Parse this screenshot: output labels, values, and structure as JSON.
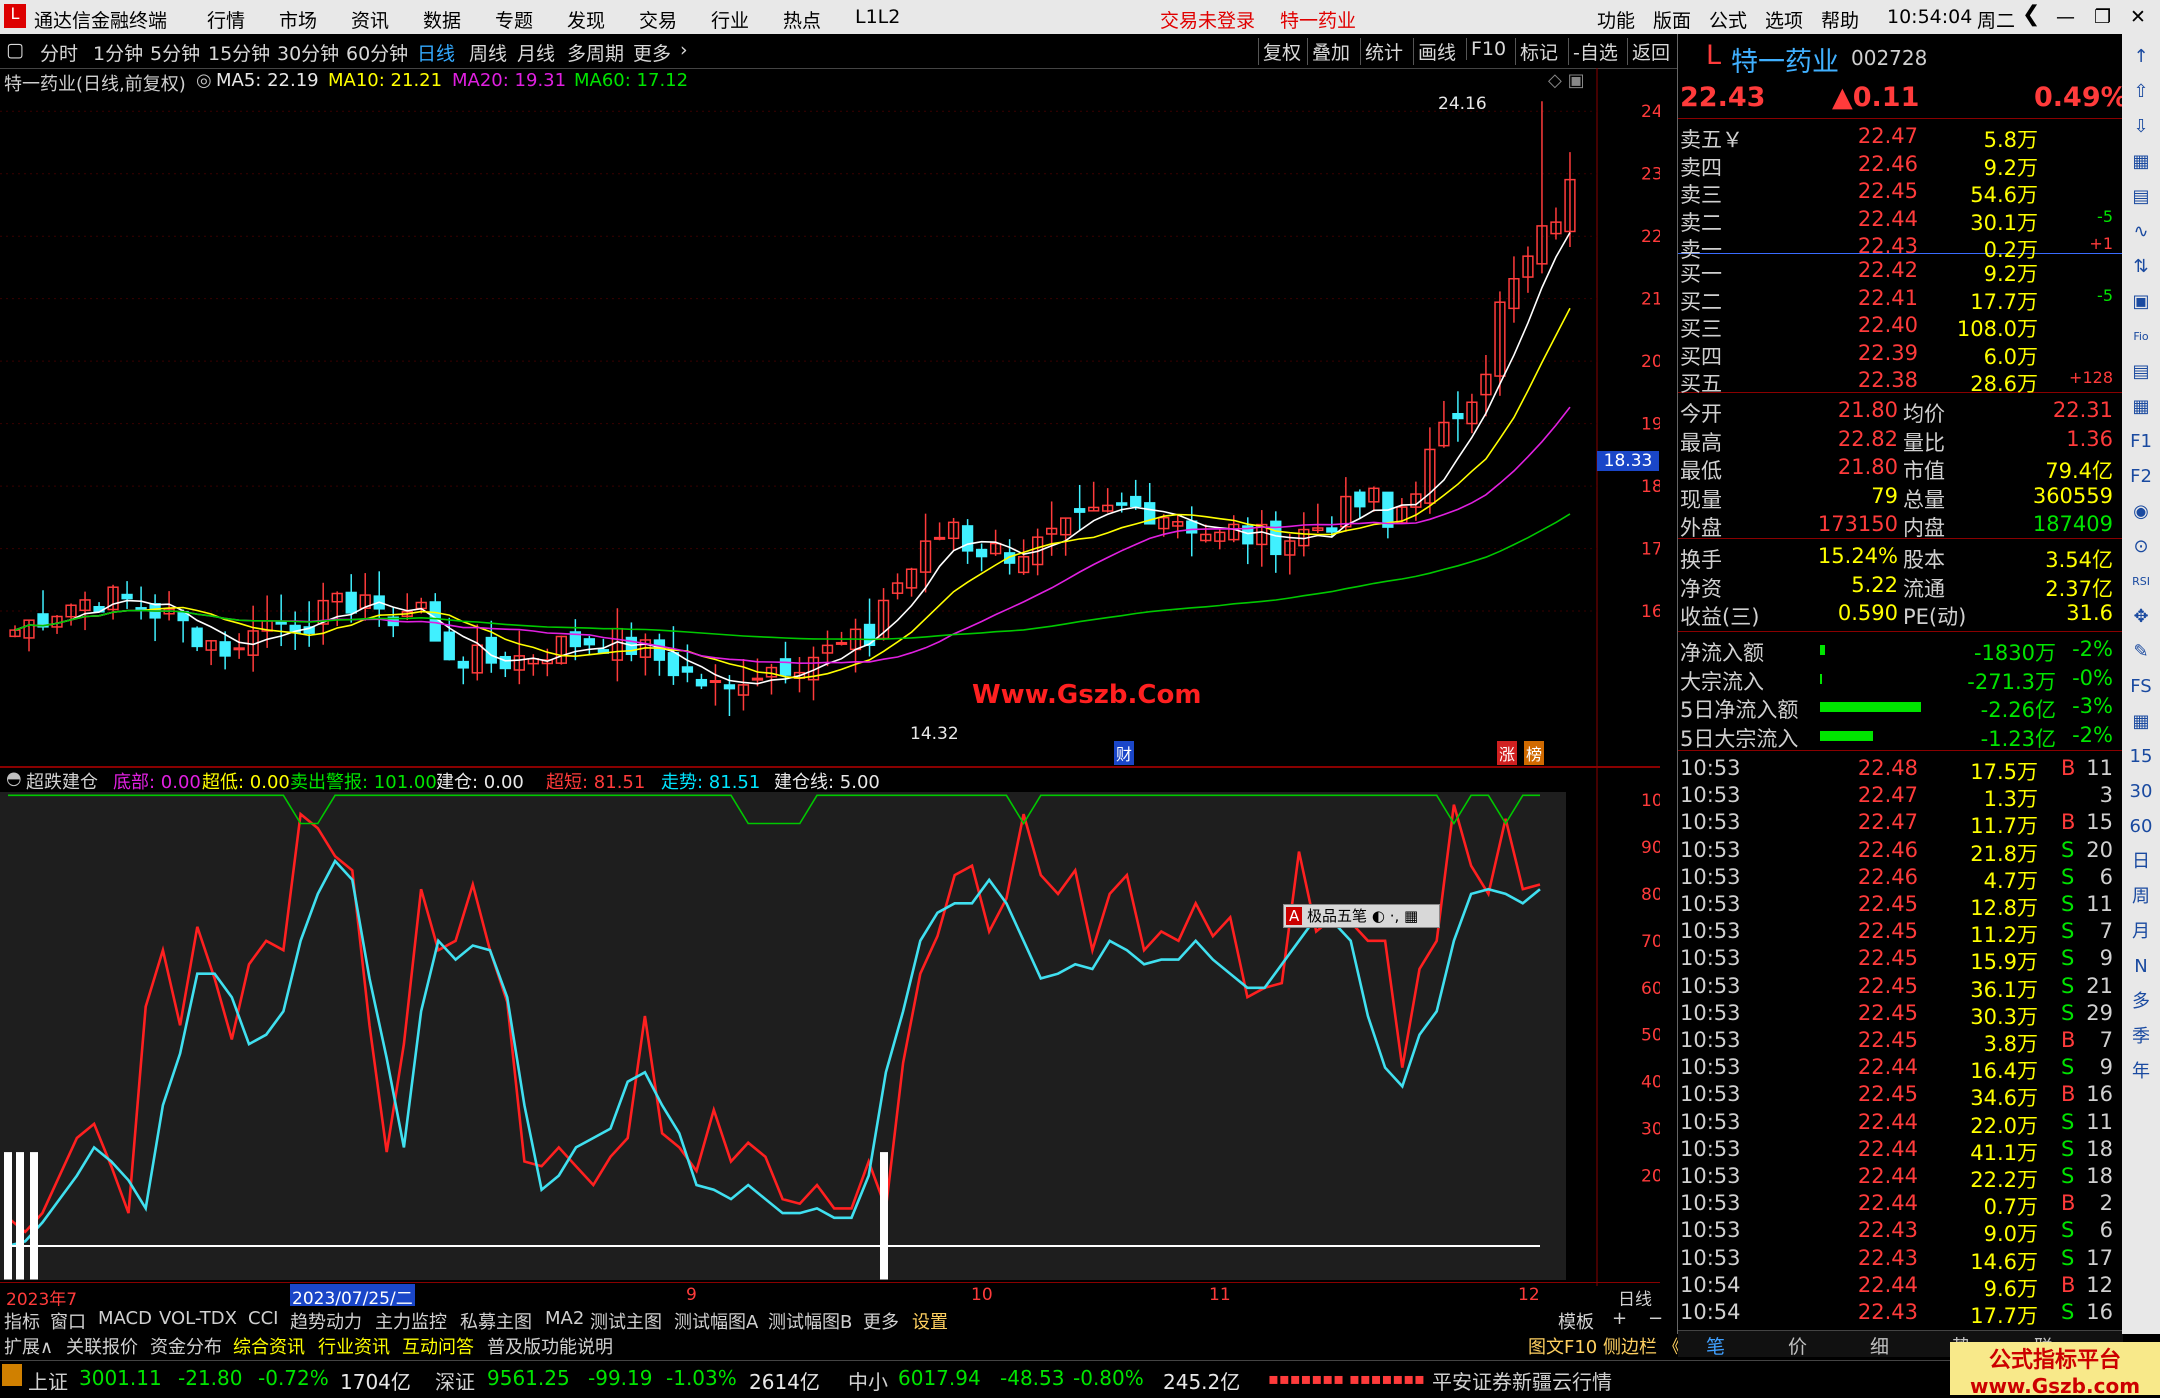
{
  "app": {
    "title": "通达信金融终端",
    "menu": [
      "行情",
      "市场",
      "资讯",
      "数据",
      "专题",
      "发现",
      "交易",
      "行业",
      "热点",
      "L1L2"
    ],
    "login_status": "交易未登录",
    "stock_tab": "特一药业",
    "right_menu": [
      "功能",
      "版面",
      "公式",
      "选项",
      "帮助"
    ],
    "clock": "10:54:04",
    "weekday": "周二"
  },
  "timeframes": [
    "分时",
    "1分钟",
    "5分钟",
    "15分钟",
    "30分钟",
    "60分钟",
    "日线",
    "周线",
    "月线",
    "多周期",
    "更多"
  ],
  "active_timeframe": "日线",
  "toolbar_right": [
    "复权",
    "叠加",
    "统计",
    "画线",
    "F10",
    "标记",
    "-自选",
    "返回"
  ],
  "main_chart": {
    "stock_label": "特一药业(日线,前复权)",
    "ma5": "MA5: 22.19",
    "ma10": "MA10: 21.21",
    "ma20": "MA20: 19.31",
    "ma60": "MA60: 17.12",
    "high_label": "24.16",
    "low_label": "14.32",
    "price_axis": [
      "24.00",
      "23.00",
      "22.00",
      "21.00",
      "20.00",
      "19.00",
      "18.00",
      "17.00",
      "16.00"
    ],
    "current_price_tag": "18.33",
    "watermark": "Www.Gszb.Com",
    "marker_cai": "财",
    "marker_zhang": "涨",
    "marker_bang": "榜",
    "colors": {
      "up": "#ff3b3b",
      "down": "#40f0ff",
      "ma5": "#ffffff",
      "ma10": "#ffff00",
      "ma20": "#e020e0",
      "ma60": "#00c800"
    }
  },
  "indicator": {
    "name": "超跌建仓",
    "bottom": "底部: 0.00",
    "super_low": "超低: 0.00",
    "sell_warn": "卖出警报: 101.00",
    "build": "建仓: 0.00",
    "overshort": "超短: 81.51",
    "trend": "走势: 81.51",
    "build_line": "建仓线: 5.00",
    "axis": [
      "100.00",
      "90.00",
      "80.00",
      "70.00",
      "60.00",
      "50.00",
      "40.00",
      "30.00",
      "20.00"
    ],
    "popup_label": "极品五笔",
    "popup_letter": "A"
  },
  "date_axis": {
    "labels": [
      "2023年7",
      "2023/07/25/二",
      "9",
      "10",
      "11",
      "12"
    ],
    "period": "日线"
  },
  "chart_data": [
    {
      "type": "line",
      "title": "超跌建仓",
      "series": [
        {
          "name": "超短",
          "values": [
            11,
            8,
            12,
            20,
            28,
            31,
            22,
            12,
            56,
            68,
            52,
            73,
            62,
            49,
            65,
            70,
            68,
            97,
            94,
            88,
            85,
            52,
            25,
            48,
            81,
            68,
            70,
            82,
            68,
            57,
            23,
            22,
            26,
            22,
            18,
            24,
            28,
            54,
            29,
            26,
            21,
            34,
            23,
            27,
            24,
            15,
            14,
            18,
            13,
            13,
            23,
            13,
            44,
            63,
            71,
            84,
            86,
            72,
            79,
            97,
            84,
            80,
            85,
            68,
            80,
            84,
            68,
            72,
            70,
            78,
            71,
            75,
            58,
            60,
            61,
            89,
            72,
            75,
            74,
            70,
            70,
            43,
            64,
            70,
            99,
            86,
            80,
            96,
            81,
            82
          ]
        },
        {
          "name": "走势",
          "values": [
            5,
            6,
            10,
            15,
            20,
            26,
            23,
            19,
            13,
            35,
            46,
            63,
            63,
            58,
            48,
            50,
            55,
            70,
            80,
            87,
            83,
            62,
            45,
            26,
            55,
            70,
            66,
            69,
            68,
            58,
            35,
            17,
            20,
            26,
            28,
            30,
            40,
            42,
            35,
            29,
            18,
            17,
            15,
            18,
            15,
            12,
            12,
            13,
            11,
            11,
            20,
            42,
            55,
            70,
            76,
            78,
            78,
            83,
            78,
            70,
            62,
            63,
            65,
            64,
            70,
            68,
            65,
            66,
            66,
            70,
            66,
            63,
            60,
            60,
            65,
            70,
            75,
            74,
            70,
            54,
            43,
            39,
            50,
            55,
            70,
            80,
            81,
            80,
            78,
            81
          ]
        }
      ],
      "ylim": [
        0,
        100
      ]
    }
  ],
  "quote_panel": {
    "code_prefix": "L",
    "name": "特一药业",
    "code": "002728",
    "price": "22.43",
    "change": "▲0.11",
    "change_pct": "0.49%",
    "asks": [
      {
        "label": "卖五",
        "price": "22.47",
        "vol": "5.8万",
        "chg": ""
      },
      {
        "label": "卖四",
        "price": "22.46",
        "vol": "9.2万",
        "chg": ""
      },
      {
        "label": "卖三",
        "price": "22.45",
        "vol": "54.6万",
        "chg": ""
      },
      {
        "label": "卖二",
        "price": "22.44",
        "vol": "30.1万",
        "chg": "-5"
      },
      {
        "label": "卖一",
        "price": "22.43",
        "vol": "0.2万",
        "chg": "+1"
      }
    ],
    "ask5_suffix": "￥",
    "bids": [
      {
        "label": "买一",
        "price": "22.42",
        "vol": "9.2万",
        "chg": ""
      },
      {
        "label": "买二",
        "price": "22.41",
        "vol": "17.7万",
        "chg": "-5"
      },
      {
        "label": "买三",
        "price": "22.40",
        "vol": "108.0万",
        "chg": ""
      },
      {
        "label": "买四",
        "price": "22.39",
        "vol": "6.0万",
        "chg": ""
      },
      {
        "label": "买五",
        "price": "22.38",
        "vol": "28.6万",
        "chg": "+128"
      }
    ],
    "stats": [
      {
        "l1": "今开",
        "v1": "21.80",
        "l2": "均价",
        "v2": "22.31"
      },
      {
        "l1": "最高",
        "v1": "22.82",
        "l2": "量比",
        "v2": "1.36"
      },
      {
        "l1": "最低",
        "v1": "21.80",
        "l2": "市值",
        "v2": "79.4亿"
      },
      {
        "l1": "现量",
        "v1": "79",
        "l2": "总量",
        "v2": "360559"
      },
      {
        "l1": "外盘",
        "v1": "173150",
        "l2": "内盘",
        "v2": "187409"
      }
    ],
    "stats2": [
      {
        "l1": "换手",
        "v1": "15.24%",
        "l2": "股本",
        "v2": "3.54亿"
      },
      {
        "l1": "净资",
        "v1": "5.22",
        "l2": "流通",
        "v2": "2.37亿"
      },
      {
        "l1": "收益(三)",
        "v1": "0.590",
        "l2": "PE(动)",
        "v2": "31.6"
      }
    ],
    "flows": [
      {
        "label": "净流入额",
        "val": "-1830万",
        "pct": "-2%",
        "bar": 0.05
      },
      {
        "label": "大宗流入",
        "val": "-271.3万",
        "pct": "-0%",
        "bar": 0.01
      },
      {
        "label": "5日净流入额",
        "val": "-2.26亿",
        "pct": "-3%",
        "bar": 0.95
      },
      {
        "label": "5日大宗流入",
        "val": "-1.23亿",
        "pct": "-2%",
        "bar": 0.5
      }
    ],
    "ticks": [
      [
        "10:53",
        "22.48",
        "17.5万",
        "B",
        "11"
      ],
      [
        "10:53",
        "22.47",
        "1.3万",
        "",
        "3"
      ],
      [
        "10:53",
        "22.47",
        "11.7万",
        "B",
        "15"
      ],
      [
        "10:53",
        "22.46",
        "21.8万",
        "S",
        "20"
      ],
      [
        "10:53",
        "22.46",
        "4.7万",
        "S",
        "6"
      ],
      [
        "10:53",
        "22.45",
        "12.8万",
        "S",
        "11"
      ],
      [
        "10:53",
        "22.45",
        "11.2万",
        "S",
        "7"
      ],
      [
        "10:53",
        "22.45",
        "15.9万",
        "S",
        "9"
      ],
      [
        "10:53",
        "22.45",
        "36.1万",
        "S",
        "21"
      ],
      [
        "10:53",
        "22.45",
        "30.3万",
        "S",
        "29"
      ],
      [
        "10:53",
        "22.45",
        "3.8万",
        "B",
        "7"
      ],
      [
        "10:53",
        "22.44",
        "16.4万",
        "S",
        "9"
      ],
      [
        "10:53",
        "22.45",
        "34.6万",
        "B",
        "16"
      ],
      [
        "10:53",
        "22.44",
        "22.0万",
        "S",
        "11"
      ],
      [
        "10:53",
        "22.44",
        "41.1万",
        "S",
        "18"
      ],
      [
        "10:53",
        "22.44",
        "22.2万",
        "S",
        "18"
      ],
      [
        "10:53",
        "22.44",
        "0.7万",
        "B",
        "2"
      ],
      [
        "10:53",
        "22.43",
        "9.0万",
        "S",
        "6"
      ],
      [
        "10:53",
        "22.43",
        "14.6万",
        "S",
        "17"
      ],
      [
        "10:54",
        "22.44",
        "9.6万",
        "B",
        "12"
      ],
      [
        "10:54",
        "22.43",
        "17.7万",
        "S",
        "16"
      ]
    ],
    "bottom_tabs": [
      "笔",
      "价",
      "细",
      "势",
      "联"
    ]
  },
  "side_tools": [
    "↑",
    "⇧",
    "⇩",
    "▦",
    "▤",
    "∿",
    "⇅",
    "▣",
    "Fio",
    "▤",
    "▦",
    "F1",
    "F2",
    "◉",
    "⊙",
    "RSI",
    "✥",
    "✎",
    "FS",
    "▦",
    "15",
    "30",
    "60",
    "日",
    "周",
    "月",
    "N",
    "多",
    "季",
    "年"
  ],
  "indicator_tabs": [
    "指标",
    "窗口",
    "MACD",
    "VOL-TDX",
    "CCI",
    "趋势动力",
    "主力监控",
    "私募主图",
    "MA2",
    "测试主图",
    "测试幅图A",
    "测试幅图B",
    "更多",
    "设置"
  ],
  "indicator_tabs_right": [
    "模板",
    "+",
    "−"
  ],
  "info_tabs": [
    "扩展∧",
    "关联报价",
    "资金分布",
    "综合资讯",
    "行业资讯",
    "互动问答",
    "普及版功能说明"
  ],
  "info_right": "图文F10 侧边栏 《",
  "status": {
    "sh_label": "上证",
    "sh_val": "3001.11",
    "sh_chg": "-21.80",
    "sh_pct": "-0.72%",
    "sh_amt": "1704亿",
    "sz_label": "深证",
    "sz_val": "9561.25",
    "sz_chg": "-99.19",
    "sz_pct": "-1.03%",
    "sz_amt": "2614亿",
    "zx_label": "中小",
    "zx_val": "6017.94",
    "zx_chg": "-48.53",
    "zx_pct": "-0.80%",
    "zx_amt": "245.2亿",
    "broker": "平安证券新疆云行情"
  },
  "watermark2": {
    "line1": "公式指标平台",
    "line2": "www.Gszb.com"
  }
}
